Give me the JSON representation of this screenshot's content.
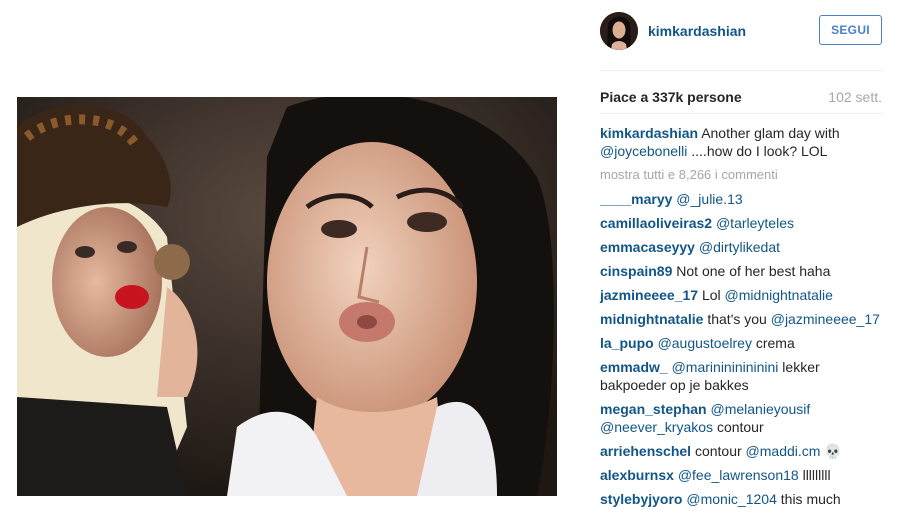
{
  "post": {
    "author": "kimkardashian",
    "follow_label": "SEGUI",
    "likes": "Piace a 337k persone",
    "time_ago": "102 sett."
  },
  "caption": {
    "user": "kimkardashian",
    "text": "Another glam day with",
    "mention": "@joycebonelli",
    "text2": "....how do I look? LOL"
  },
  "show_all": "mostra tutti e 8,266 i commenti",
  "comments": [
    {
      "user": "____maryy",
      "parts": [
        {
          "m": "@_julie.13"
        }
      ]
    },
    {
      "user": "camillaoliveiras2",
      "parts": [
        {
          "m": "@tarleyteles"
        }
      ]
    },
    {
      "user": "emmacaseyyy",
      "parts": [
        {
          "m": "@dirtylikedat"
        }
      ]
    },
    {
      "user": "cinspain89",
      "parts": [
        {
          "t": "Not one of her best haha"
        }
      ]
    },
    {
      "user": "jazmineeee_17",
      "parts": [
        {
          "t": "Lol"
        },
        {
          "m": "@midnightnatalie"
        }
      ]
    },
    {
      "user": "midnightnatalie",
      "parts": [
        {
          "t": "that's you"
        },
        {
          "m": "@jazmineeee_17"
        }
      ]
    },
    {
      "user": "la_pupo",
      "parts": [
        {
          "m": "@augustoelrey"
        },
        {
          "t": "crema"
        }
      ]
    },
    {
      "user": "emmadw_",
      "parts": [
        {
          "m": "@marinininininini"
        },
        {
          "t": "lekker bakpoeder op je bakkes"
        }
      ]
    },
    {
      "user": "megan_stephan",
      "parts": [
        {
          "m": "@melanieyousif"
        },
        {
          "m": "@neever_kryakos"
        },
        {
          "t": "contour"
        }
      ]
    },
    {
      "user": "arriehenschel",
      "parts": [
        {
          "t": "contour"
        },
        {
          "m": "@maddi.cm"
        },
        {
          "t": "💀"
        }
      ]
    },
    {
      "user": "alexburnsx",
      "parts": [
        {
          "m": "@fee_lawrenson18"
        },
        {
          "t": "lllllllll"
        }
      ]
    },
    {
      "user": "stylebyjyoro",
      "parts": [
        {
          "m": "@monic_1204"
        },
        {
          "t": "this much"
        }
      ]
    }
  ]
}
